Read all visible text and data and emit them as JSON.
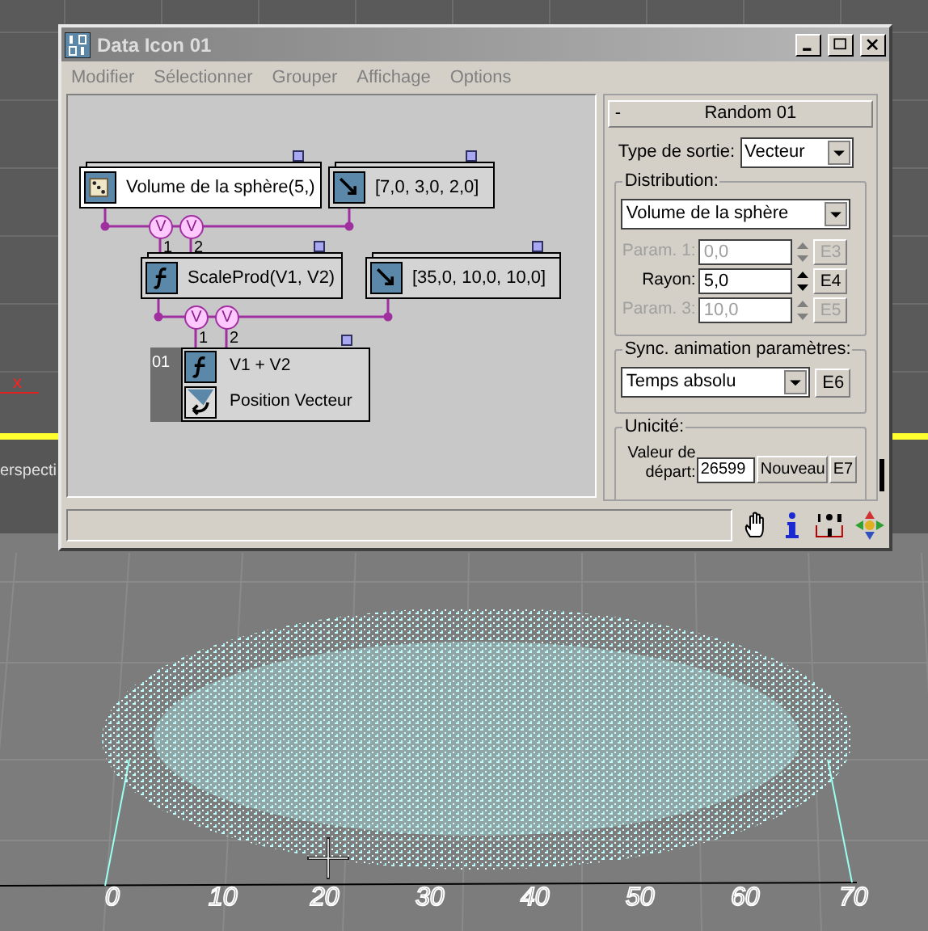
{
  "viewport": {
    "axis_label": "x",
    "view_label": "erspecti",
    "ruler": [
      "0",
      "10",
      "20",
      "30",
      "40",
      "50",
      "60",
      "70"
    ]
  },
  "window": {
    "title": "Data Icon 01",
    "menu": [
      "Modifier",
      "Sélectionner",
      "Grouper",
      "Affichage",
      "Options"
    ]
  },
  "graph": {
    "nodes": [
      {
        "kind": "single",
        "label": "Volume de la sphère(5,)",
        "selected": true
      },
      {
        "kind": "single",
        "label": "[7,0, 3,0, 2,0]",
        "selected": false
      },
      {
        "kind": "single",
        "label": "ScaleProd(V1, V2)",
        "selected": false,
        "inputs": [
          {
            "symbol": "V",
            "port": "1"
          },
          {
            "symbol": "V",
            "port": "2"
          }
        ]
      },
      {
        "kind": "single",
        "label": "[35,0, 10,0, 10,0]",
        "selected": false
      },
      {
        "kind": "output",
        "badge": "01",
        "selected": false,
        "rows": [
          {
            "label": "V1 + V2"
          },
          {
            "label": "Position Vecteur"
          }
        ],
        "inputs": [
          {
            "symbol": "V",
            "port": "1"
          },
          {
            "symbol": "V",
            "port": "2"
          }
        ]
      }
    ]
  },
  "panel": {
    "rollout": {
      "toggle": "-",
      "title": "Random 01"
    },
    "output_type": {
      "label": "Type de sortie:",
      "value": "Vecteur"
    },
    "distribution": {
      "title": "Distribution:",
      "value": "Volume de la sphère",
      "params": [
        {
          "label": "Param. 1:",
          "value": "0,0",
          "button": "E3",
          "disabled": true
        },
        {
          "label": "Rayon:",
          "value": "5,0",
          "button": "E4",
          "disabled": false
        },
        {
          "label": "Param. 3:",
          "value": "10,0",
          "button": "E5",
          "disabled": true
        }
      ]
    },
    "sync": {
      "title": "Sync. animation paramètres:",
      "value": "Temps absolu",
      "button": "E6"
    },
    "uniqueness": {
      "title": "Unicité:",
      "label": "Valeur de départ:",
      "value": "26599",
      "buttons": [
        "Nouveau",
        "E7"
      ]
    }
  }
}
